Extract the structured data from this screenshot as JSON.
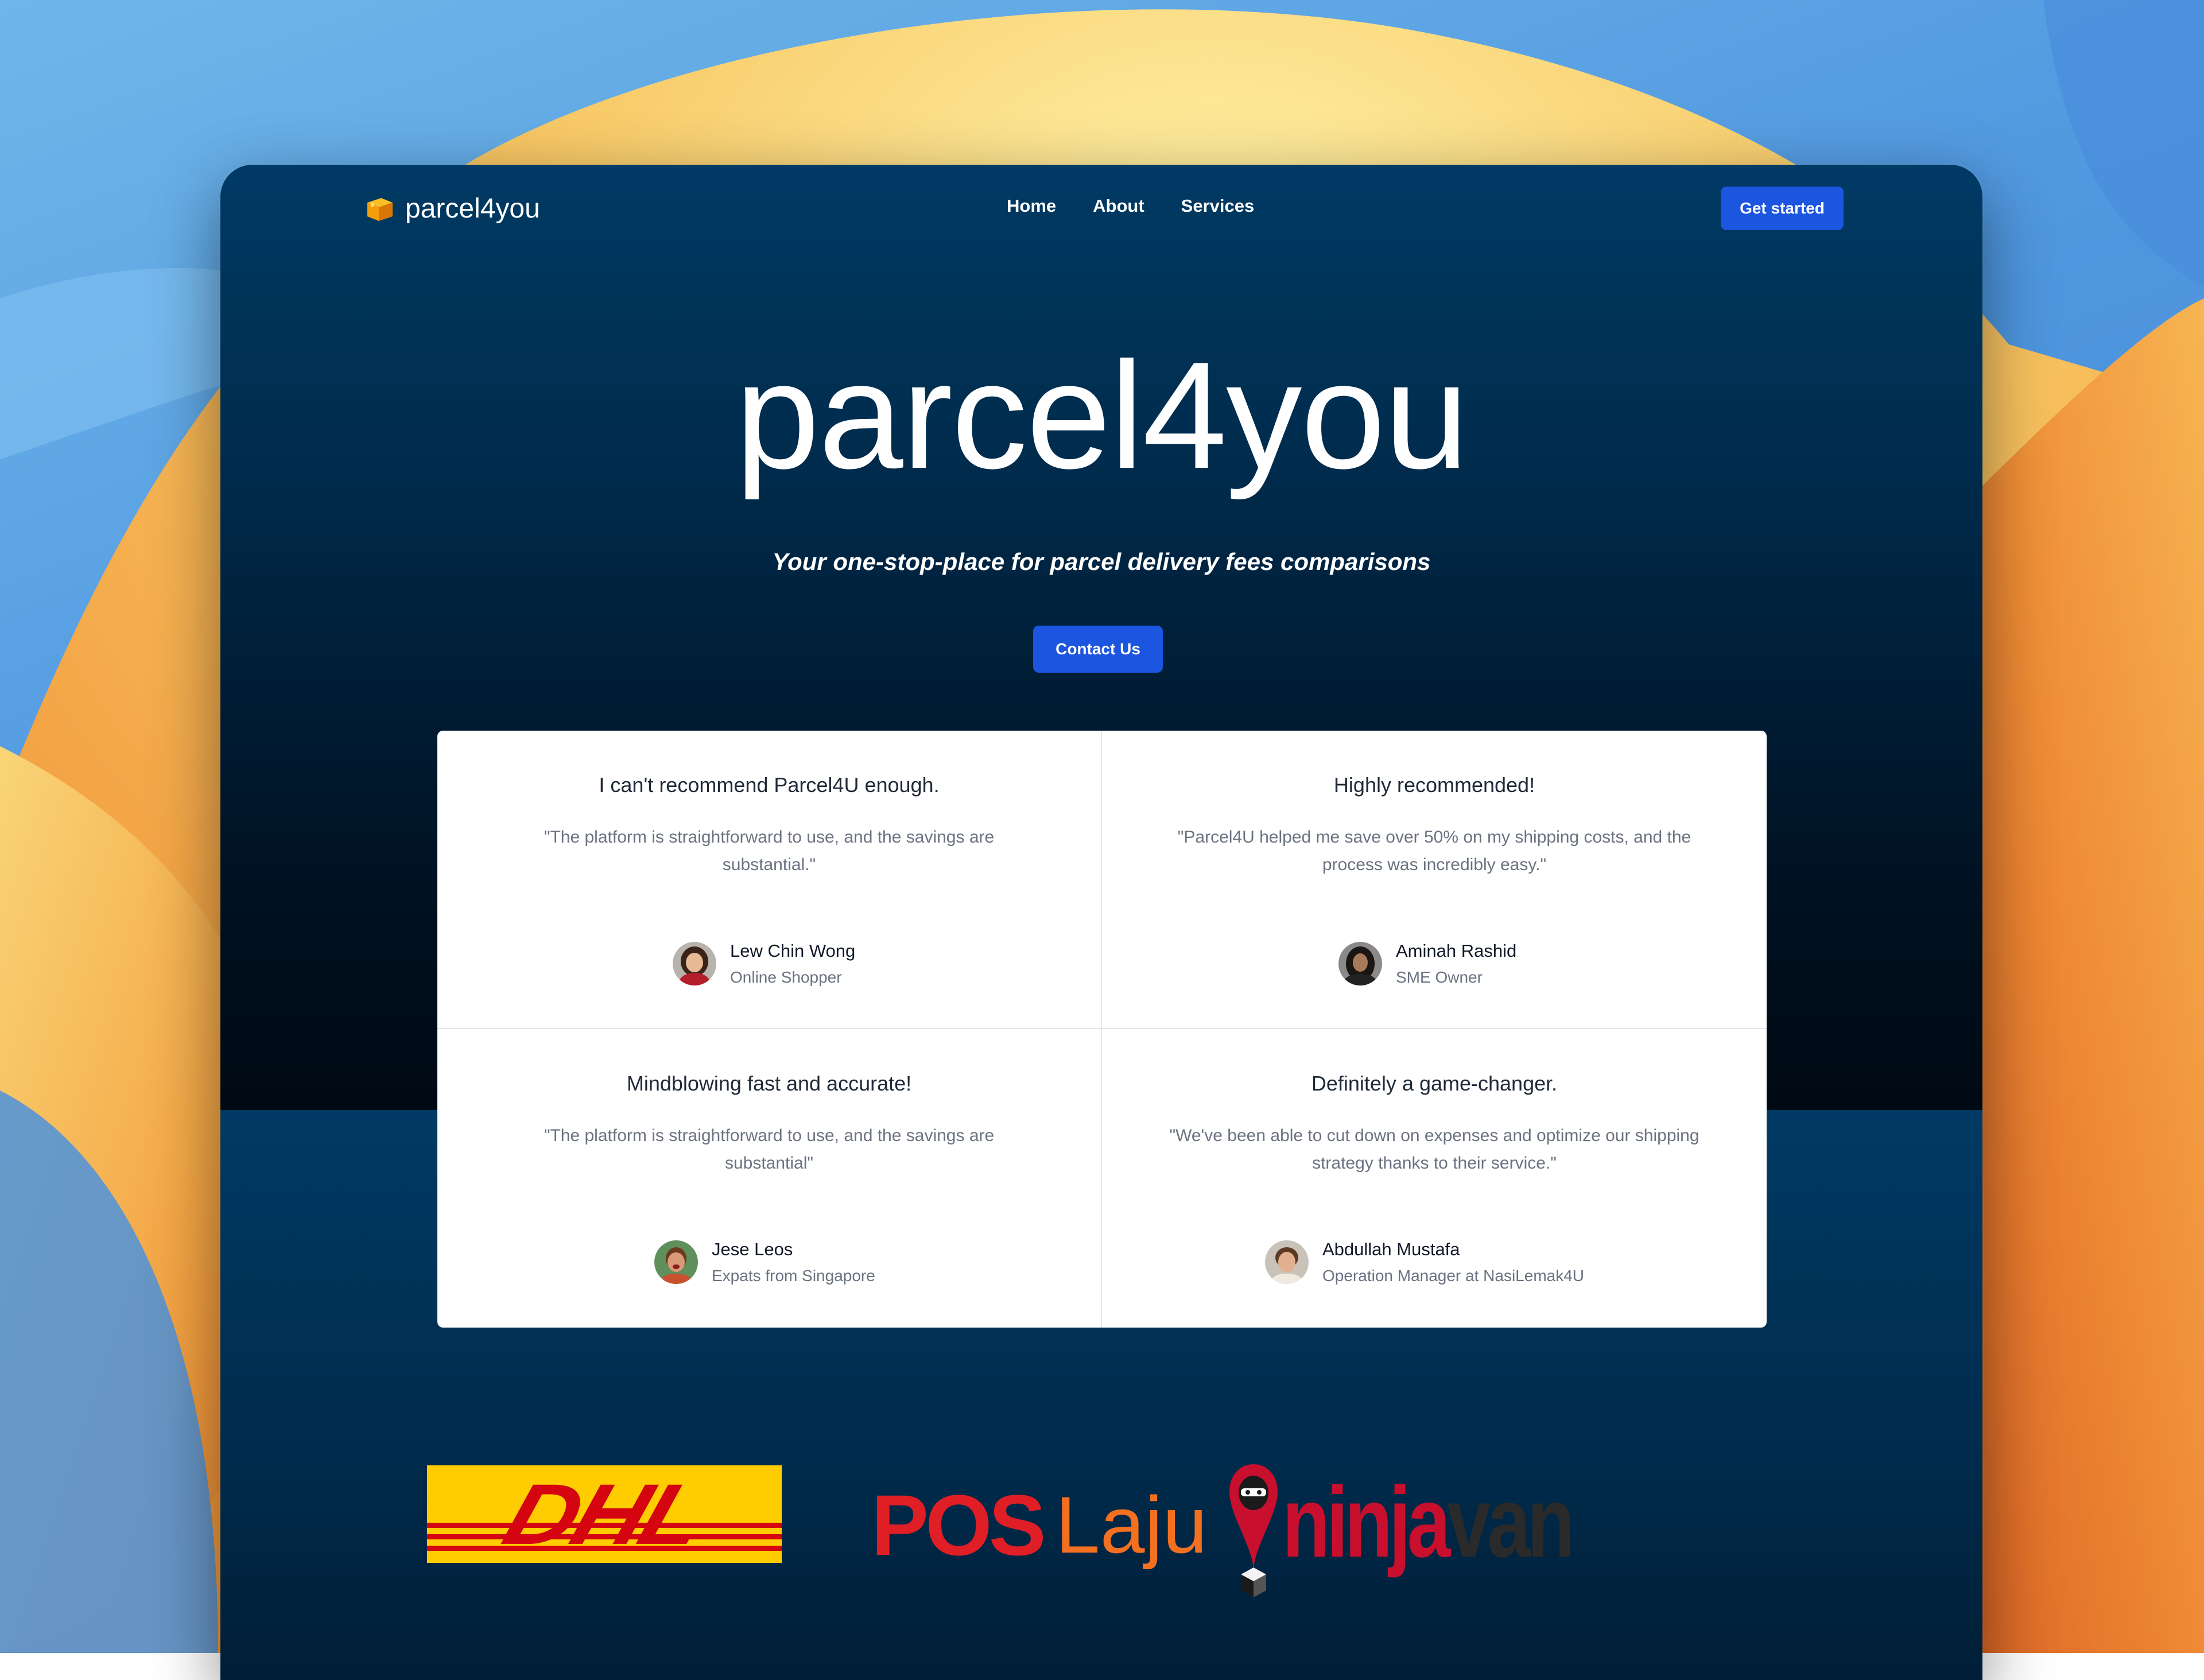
{
  "brand": {
    "logo_text": "parcel4you",
    "accent": "#1c55e0",
    "logo_color": "#f59e0b"
  },
  "nav": {
    "links": [
      {
        "label": "Home"
      },
      {
        "label": "About"
      },
      {
        "label": "Services"
      }
    ],
    "cta": "Get started"
  },
  "hero": {
    "title": "parcel4you",
    "subtitle": "Your one-stop-place for parcel delivery fees comparisons",
    "cta": "Contact Us"
  },
  "testimonials": [
    {
      "title": "I can't recommend Parcel4U enough.",
      "quote": "\"The platform is straightforward to use, and the savings are substantial.\"",
      "name": "Lew Chin Wong",
      "role": "Online Shopper"
    },
    {
      "title": "Highly recommended!",
      "quote": "\"Parcel4U helped me save over 50% on my shipping costs, and the process was incredibly easy.\"",
      "name": "Aminah Rashid",
      "role": "SME Owner"
    },
    {
      "title": "Mindblowing fast and accurate!",
      "quote": "\"The platform is straightforward to use, and the savings are substantial\"",
      "name": "Jese Leos",
      "role": "Expats from Singapore"
    },
    {
      "title": "Definitely a game-changer.",
      "quote": "\"We've been able to cut down on expenses and optimize our shipping strategy thanks to their service.\"",
      "name": "Abdullah Mustafa",
      "role": "Operation Manager at NasiLemak4U"
    }
  ],
  "partners": {
    "dhl": {
      "text": "DHL",
      "bg": "#ffcc00",
      "fg": "#d40511"
    },
    "poslaju": {
      "pos": "POS",
      "laju": "Laju",
      "pos_color": "#e01e26",
      "laju_color": "#f37021"
    },
    "ninjavan": {
      "ninja": "ninja",
      "van": "van",
      "ninja_color": "#c8102e",
      "van_color": "#2a2a2a"
    }
  }
}
